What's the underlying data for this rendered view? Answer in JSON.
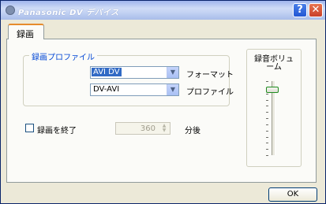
{
  "window": {
    "title": "Panasonic DV デバイス"
  },
  "tabs": [
    {
      "label": "録画"
    }
  ],
  "profile_group": {
    "title": "録画プロファイル",
    "format": {
      "value": "AVI DV",
      "label": "フォーマット"
    },
    "profile": {
      "value": "DV-AVI",
      "label": "プロファイル"
    }
  },
  "stop_recording": {
    "label": "録画を終了",
    "checked": false,
    "minutes": "360",
    "unit": "分後"
  },
  "volume": {
    "label_line1": "録音ボリュ",
    "label_line2": "ーム",
    "level": 0.88
  },
  "buttons": {
    "ok": "OK"
  },
  "icons": {
    "titlebar": [
      "app-icon",
      "help-icon",
      "close-icon"
    ],
    "dropdown": "chevron-down-icon"
  }
}
